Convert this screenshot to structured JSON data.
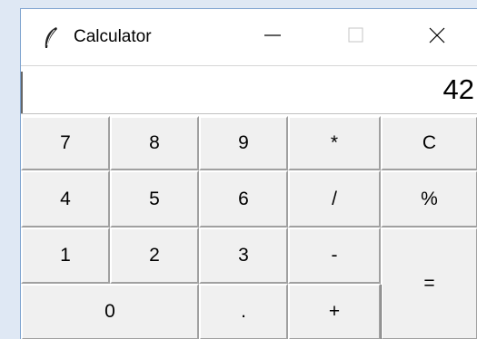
{
  "window": {
    "title": "Calculator",
    "icon": "feather-icon",
    "controls": {
      "minimize_icon": "minimize-icon",
      "maximize_icon": "maximize-icon",
      "close_icon": "close-icon"
    }
  },
  "display": {
    "value": "42"
  },
  "keypad": {
    "rows": [
      [
        "7",
        "8",
        "9",
        "*",
        "C"
      ],
      [
        "4",
        "5",
        "6",
        "/",
        "%"
      ],
      [
        "1",
        "2",
        "3",
        "-",
        "="
      ],
      [
        "0",
        ".",
        "+"
      ]
    ]
  },
  "colors": {
    "button_face": "#f0f0f0",
    "background": "#dfe8f4",
    "window_border": "#7ea3cf"
  }
}
